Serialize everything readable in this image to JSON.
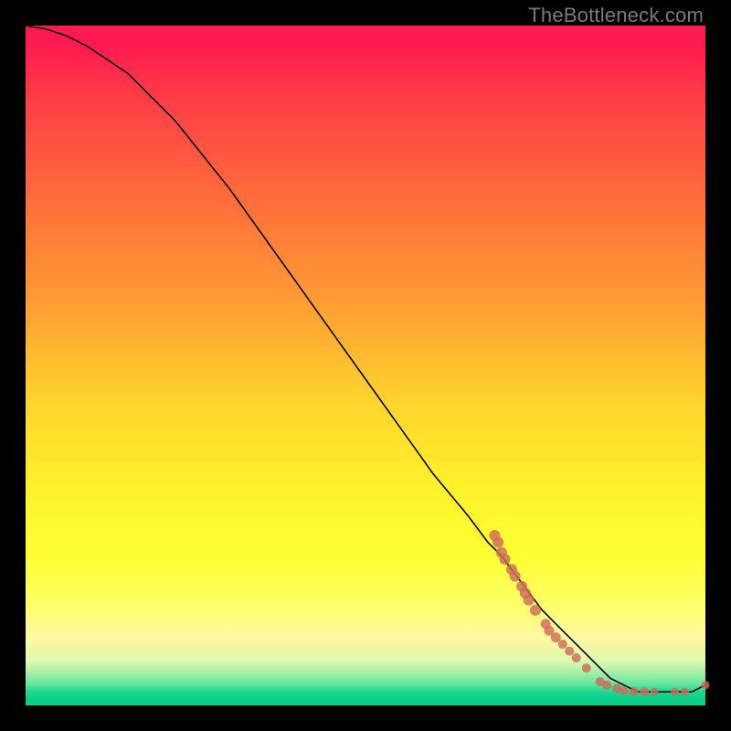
{
  "watermark": "TheBottleneck.com",
  "colors": {
    "background": "#000000",
    "line": "#000000",
    "marker": "#cf6a5d"
  },
  "chart_data": {
    "type": "line",
    "title": "",
    "xlabel": "",
    "ylabel": "",
    "xlim": [
      0,
      100
    ],
    "ylim": [
      0,
      100
    ],
    "grid": false,
    "legend": "none",
    "series": [
      {
        "name": "curve",
        "x": [
          0,
          3,
          6,
          9,
          12,
          15,
          18,
          22,
          26,
          30,
          35,
          40,
          45,
          50,
          55,
          60,
          65,
          68,
          70,
          73,
          76,
          79,
          82,
          84,
          86,
          88,
          90,
          92,
          94,
          96,
          98,
          100
        ],
        "y": [
          100,
          99.5,
          98.5,
          97,
          95,
          93,
          90,
          86,
          81,
          76,
          69,
          62,
          55,
          48,
          41,
          34,
          28,
          24,
          22,
          18,
          14,
          11,
          8,
          6,
          4,
          3,
          2,
          2,
          2,
          2,
          2,
          3
        ]
      }
    ],
    "markers": {
      "name": "cluster",
      "points": [
        {
          "x": 69,
          "y": 25,
          "r": 6
        },
        {
          "x": 69.5,
          "y": 24,
          "r": 6
        },
        {
          "x": 70,
          "y": 22.5,
          "r": 6
        },
        {
          "x": 70.5,
          "y": 21.5,
          "r": 6
        },
        {
          "x": 71.5,
          "y": 20,
          "r": 6
        },
        {
          "x": 72,
          "y": 19,
          "r": 6
        },
        {
          "x": 73,
          "y": 17.5,
          "r": 6
        },
        {
          "x": 73.5,
          "y": 16.5,
          "r": 6
        },
        {
          "x": 74,
          "y": 15.5,
          "r": 6
        },
        {
          "x": 75,
          "y": 14,
          "r": 6
        },
        {
          "x": 76.5,
          "y": 12,
          "r": 5.5
        },
        {
          "x": 77,
          "y": 11,
          "r": 5.5
        },
        {
          "x": 78,
          "y": 10,
          "r": 5.5
        },
        {
          "x": 79,
          "y": 9,
          "r": 5
        },
        {
          "x": 80,
          "y": 8,
          "r": 5
        },
        {
          "x": 81,
          "y": 7,
          "r": 5
        },
        {
          "x": 82.5,
          "y": 5.5,
          "r": 5
        },
        {
          "x": 84.5,
          "y": 3.5,
          "r": 5
        },
        {
          "x": 85.5,
          "y": 3,
          "r": 5
        },
        {
          "x": 87,
          "y": 2.5,
          "r": 5
        },
        {
          "x": 88,
          "y": 2.2,
          "r": 5
        },
        {
          "x": 89.5,
          "y": 2,
          "r": 5
        },
        {
          "x": 91,
          "y": 2,
          "r": 5
        },
        {
          "x": 92.5,
          "y": 2,
          "r": 4.5
        },
        {
          "x": 95.5,
          "y": 2,
          "r": 4.5
        },
        {
          "x": 97,
          "y": 2,
          "r": 4.5
        },
        {
          "x": 100,
          "y": 3,
          "r": 4.5
        }
      ]
    }
  }
}
